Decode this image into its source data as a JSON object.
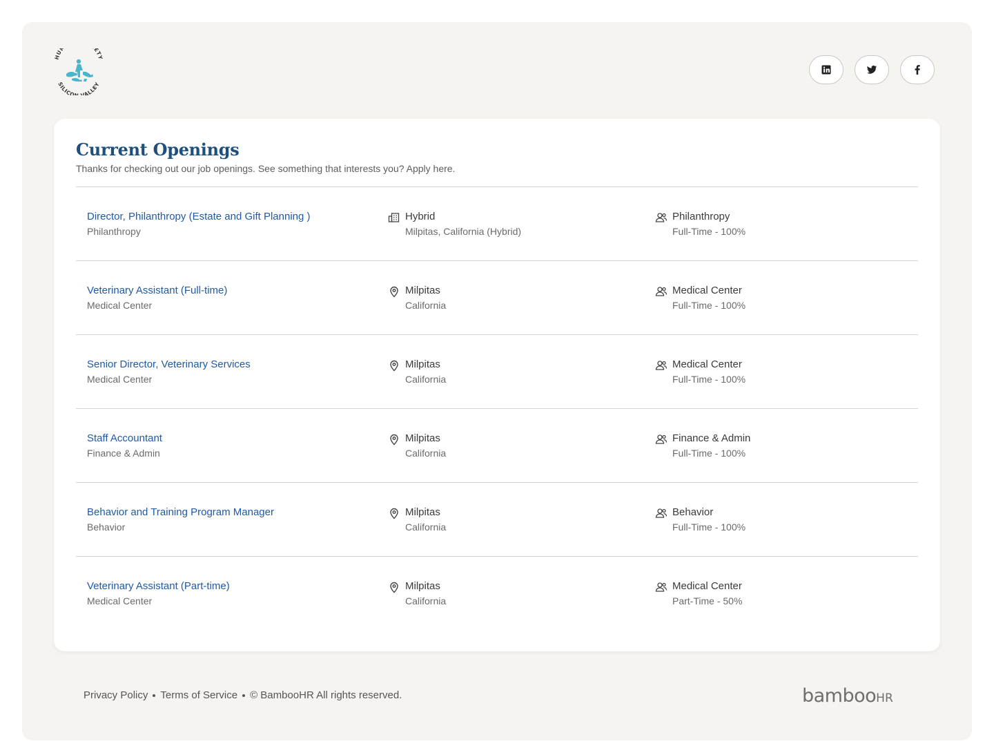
{
  "brand": {
    "logo_top_text": "HUMANE SOCIETY",
    "logo_bottom_text": "SILICON VALLEY",
    "logo_color": "#4bb6cb"
  },
  "social": [
    {
      "icon": "linkedin-icon",
      "name": "LinkedIn"
    },
    {
      "icon": "twitter-icon",
      "name": "Twitter"
    },
    {
      "icon": "facebook-icon",
      "name": "Facebook"
    }
  ],
  "header": {
    "title": "Current Openings",
    "subtitle": "Thanks for checking out our job openings. See something that interests you? Apply here."
  },
  "jobs": [
    {
      "title": "Director, Philanthropy (Estate and Gift Planning )",
      "department": "Philanthropy",
      "location_icon": "building-icon",
      "location": "Hybrid",
      "location_detail": "Milpitas, California (Hybrid)",
      "team": "Philanthropy",
      "employment": "Full-Time - 100%"
    },
    {
      "title": "Veterinary Assistant (Full-time)",
      "department": "Medical Center",
      "location_icon": "map-pin-icon",
      "location": "Milpitas",
      "location_detail": "California",
      "team": "Medical Center",
      "employment": "Full-Time - 100%"
    },
    {
      "title": "Senior Director, Veterinary Services",
      "department": "Medical Center",
      "location_icon": "map-pin-icon",
      "location": "Milpitas",
      "location_detail": "California",
      "team": "Medical Center",
      "employment": "Full-Time - 100%"
    },
    {
      "title": "Staff Accountant",
      "department": "Finance & Admin",
      "location_icon": "map-pin-icon",
      "location": "Milpitas",
      "location_detail": "California",
      "team": "Finance & Admin",
      "employment": "Full-Time - 100%"
    },
    {
      "title": "Behavior and Training Program Manager",
      "department": "Behavior",
      "location_icon": "map-pin-icon",
      "location": "Milpitas",
      "location_detail": "California",
      "team": "Behavior",
      "employment": "Full-Time - 100%"
    },
    {
      "title": "Veterinary Assistant (Part-time)",
      "department": "Medical Center",
      "location_icon": "map-pin-icon",
      "location": "Milpitas",
      "location_detail": "California",
      "team": "Medical Center",
      "employment": "Part-Time - 50%"
    }
  ],
  "footer": {
    "privacy": "Privacy Policy",
    "terms": "Terms of Service",
    "copyright": "© BambooHR All rights reserved.",
    "brand_main": "bamboo",
    "brand_suffix": "HR"
  },
  "colors": {
    "page_bg": "#f5f4f1",
    "title": "#1e4f7d",
    "link": "#1e5aa8",
    "text": "#3a3a3a",
    "muted": "#6a6a6a"
  }
}
